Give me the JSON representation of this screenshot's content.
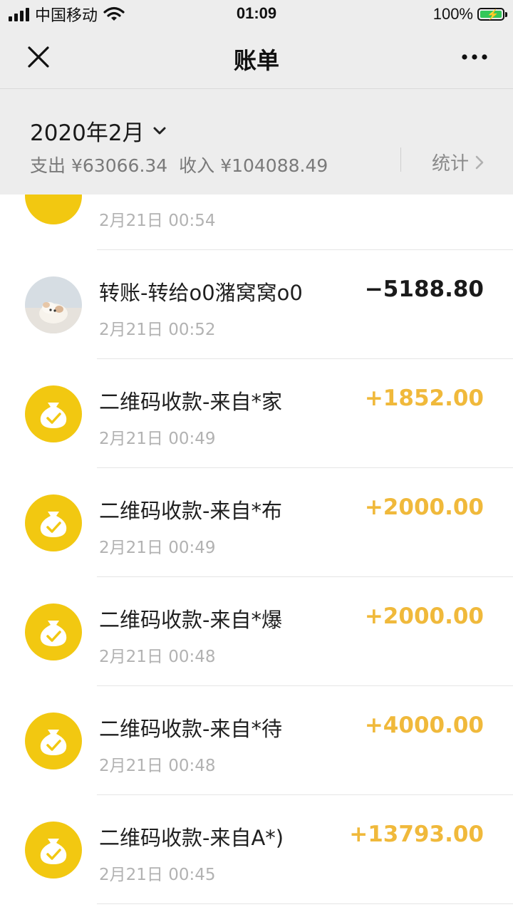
{
  "status_bar": {
    "carrier": "中国移动",
    "time": "01:09",
    "battery": "100%"
  },
  "nav": {
    "title": "账单"
  },
  "summary": {
    "month": "2020年2月",
    "expense_label": "支出",
    "expense": "¥63066.34",
    "income_label": "收入",
    "income": "¥104088.49",
    "stats_label": "统计"
  },
  "transactions": [
    {
      "title": "",
      "time": "2月21日 00:54",
      "amount": "",
      "icon": "yellow-coin-icon"
    },
    {
      "title": "转账-转给o0潴窝窝o0",
      "time": "2月21日 00:52",
      "amount": "−5188.80",
      "direction": "out",
      "icon": "avatar"
    },
    {
      "title": "二维码收款-来自*家",
      "time": "2月21日 00:49",
      "amount": "+1852.00",
      "direction": "in",
      "icon": "money-bag-icon"
    },
    {
      "title": "二维码收款-来自*布",
      "time": "2月21日 00:49",
      "amount": "+2000.00",
      "direction": "in",
      "icon": "money-bag-icon"
    },
    {
      "title": "二维码收款-来自*爆",
      "time": "2月21日 00:48",
      "amount": "+2000.00",
      "direction": "in",
      "icon": "money-bag-icon"
    },
    {
      "title": "二维码收款-来自*待",
      "time": "2月21日 00:48",
      "amount": "+4000.00",
      "direction": "in",
      "icon": "money-bag-icon"
    },
    {
      "title": "二维码收款-来自A*)",
      "time": "2月21日 00:45",
      "amount": "+13793.00",
      "direction": "in",
      "icon": "money-bag-icon"
    }
  ],
  "colors": {
    "income": "#f0b93b",
    "coin": "#f2c811",
    "header_bg": "#ededed"
  }
}
